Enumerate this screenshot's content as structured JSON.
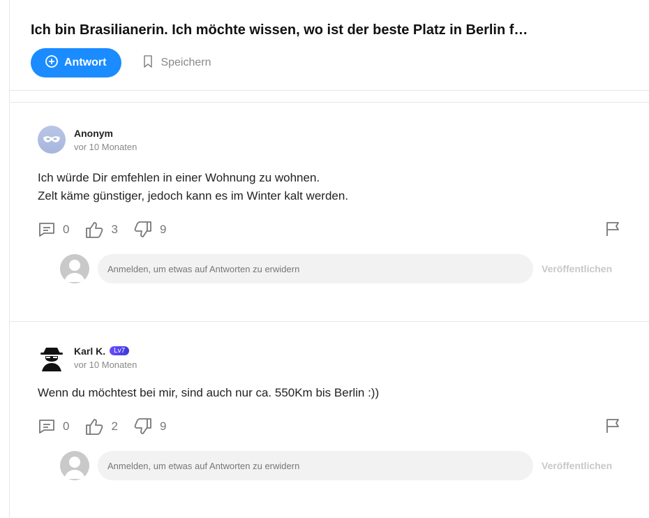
{
  "question": {
    "title": "Ich bin Brasilianerin. Ich möchte wissen, wo ist der beste Platz in Berlin f…",
    "answer_button": "Antwort",
    "save_button": "Speichern"
  },
  "answers": [
    {
      "author": "Anonym",
      "time": "vor 10 Monaten",
      "lines": [
        "Ich würde Dir emfehlen in einer Wohnung zu wohnen.",
        "Zelt käme günstiger, jedoch kann es im Winter kalt werden."
      ],
      "comments": "0",
      "likes": "3",
      "dislikes": "9",
      "reply_placeholder": "Anmelden, um etwas auf Antworten zu erwidern",
      "publish": "Veröffentlichen"
    },
    {
      "author": "Karl K.",
      "badge": "Lv7",
      "time": "vor 10 Monaten",
      "lines": [
        "Wenn du möchtest bei mir, sind auch nur ca. 550Km bis Berlin :))"
      ],
      "comments": "0",
      "likes": "2",
      "dislikes": "9",
      "reply_placeholder": "Anmelden, um etwas auf Antworten zu erwidern",
      "publish": "Veröffentlichen"
    }
  ],
  "colors": {
    "accent": "#1a8cff",
    "badge": "#5a44f0"
  }
}
